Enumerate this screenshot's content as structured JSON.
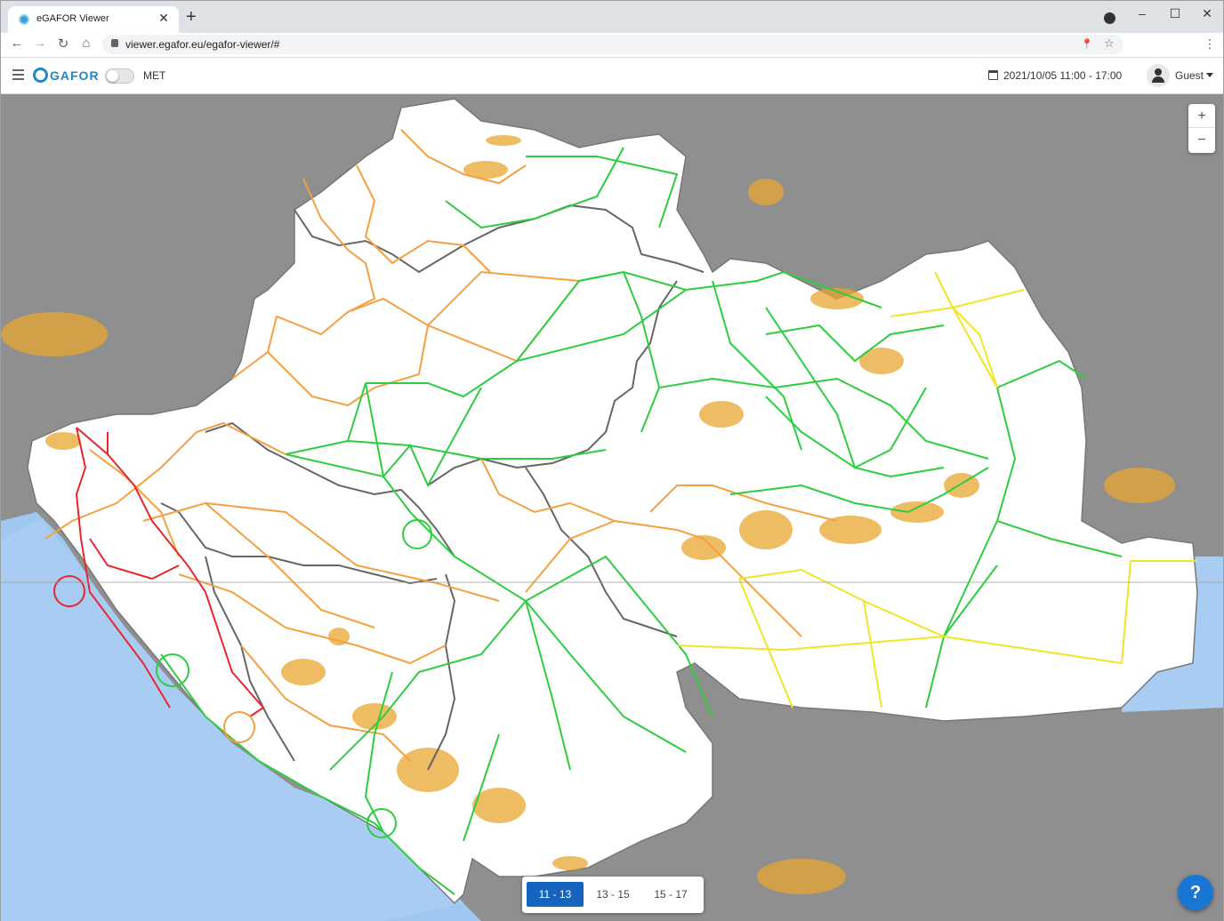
{
  "browser": {
    "tab_title": "eGAFOR Viewer",
    "tab_close": "✕",
    "new_tab": "+",
    "minimize": "–",
    "maximize": "☐",
    "close": "✕",
    "url": "viewer.egafor.eu/egafor-viewer/#",
    "back": "←",
    "forward": "→",
    "reload": "↻",
    "home": "⌂",
    "location_icon": "📍",
    "star_icon": "☆",
    "menu": "⋮"
  },
  "app": {
    "logo_text": "GAFOR",
    "met_label": "MET",
    "met_enabled": false,
    "date_range": "2021/10/05 11:00 - 17:00",
    "user_name": "Guest"
  },
  "map": {
    "zoom_in": "+",
    "zoom_out": "−",
    "time_slots": [
      "11 - 13",
      "13 - 15",
      "15 - 17"
    ],
    "active_slot": "11 - 13",
    "help": "?",
    "colors": {
      "sea": "#a9cdf2",
      "land": "#ffffff",
      "outside": "#8f8f8f",
      "route_green": "#2ecc40",
      "route_orange": "#f5a040",
      "route_red": "#e8262e",
      "route_yellow": "#f0e428",
      "terrain": "#e8a630",
      "border": "#666666"
    }
  }
}
